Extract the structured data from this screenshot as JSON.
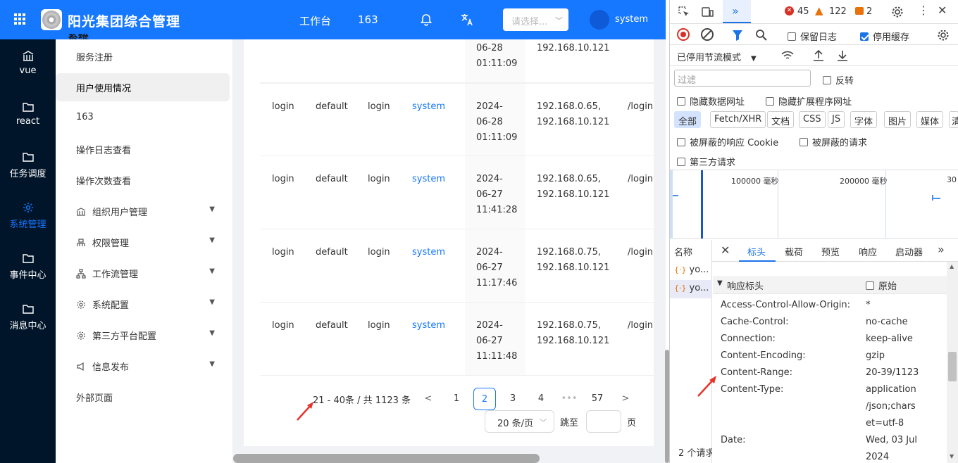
{
  "header": {
    "app_title": "阳光集团综合管理",
    "app_title_overflow": "系统",
    "workbench": "工作台",
    "count": "163",
    "select_placeholder": "请选择...",
    "username": "system"
  },
  "sider": {
    "items": [
      {
        "label": "vue",
        "icon": "bank-icon"
      },
      {
        "label": "react",
        "icon": "folder-icon"
      },
      {
        "label": "任务调度",
        "icon": "folder-icon"
      },
      {
        "label": "系统管理",
        "icon": "gear-icon"
      },
      {
        "label": "事件中心",
        "icon": "folder-icon"
      },
      {
        "label": "消息中心",
        "icon": "folder-icon"
      }
    ]
  },
  "menu": {
    "items": [
      {
        "label": "服务注册"
      },
      {
        "label": "用户使用情况"
      },
      {
        "label": "163"
      },
      {
        "label": "操作日志查看"
      },
      {
        "label": "操作次数查看"
      },
      {
        "label": "组织用户管理",
        "icon": "bank-icon"
      },
      {
        "label": "权限管理",
        "icon": "user-icon"
      },
      {
        "label": "工作流管理",
        "icon": "flow-icon"
      },
      {
        "label": "系统配置",
        "icon": "gear-icon"
      },
      {
        "label": "第三方平台配置",
        "icon": "gear-icon"
      },
      {
        "label": "信息发布",
        "icon": "sound-icon"
      },
      {
        "label": "外部页面"
      }
    ]
  },
  "table": {
    "partial_row": {
      "date1": "06-28",
      "time": "01:11:09",
      "ip": "192.168.10.121"
    },
    "rows": [
      {
        "type": "login",
        "app": "default",
        "op": "login",
        "user": "system",
        "date0": "2024-",
        "date1": "06-28",
        "time": "01:11:09",
        "ip1": "192.168.0.65,",
        "ip2": "192.168.10.121",
        "path": "/login"
      },
      {
        "type": "login",
        "app": "default",
        "op": "login",
        "user": "system",
        "date0": "2024-",
        "date1": "06-27",
        "time": "11:41:28",
        "ip1": "192.168.0.65,",
        "ip2": "192.168.10.121",
        "path": "/login"
      },
      {
        "type": "login",
        "app": "default",
        "op": "login",
        "user": "system",
        "date0": "2024-",
        "date1": "06-27",
        "time": "11:17:46",
        "ip1": "192.168.0.75,",
        "ip2": "192.168.10.121",
        "path": "/login"
      },
      {
        "type": "login",
        "app": "default",
        "op": "login",
        "user": "system",
        "date0": "2024-",
        "date1": "06-27",
        "time": "11:11:48",
        "ip1": "192.168.0.75,",
        "ip2": "192.168.10.121",
        "path": "/login"
      }
    ]
  },
  "pagination": {
    "range": "21 - 40条 / 共 1123 条",
    "pages": [
      "1",
      "2",
      "3",
      "4",
      "•••",
      "57"
    ],
    "current": "2",
    "page_size": "20 条/页",
    "jump_label": "跳至",
    "page_suffix": "页"
  },
  "devtools": {
    "errors": "45",
    "warnings": "122",
    "issues": "2",
    "preserve_log": "保留日志",
    "disable_cache": "停用缓存",
    "throttle": "已停用节流模式",
    "filter_placeholder": "过滤",
    "invert": "反转",
    "hide_data_urls": "隐藏数据网址",
    "hide_ext_urls": "隐藏扩展程序网址",
    "types": [
      "全部",
      "Fetch/XHR",
      "文档",
      "CSS",
      "JS",
      "字体",
      "图片",
      "媒体",
      "清"
    ],
    "blocked_cookies": "被屏蔽的响应 Cookie",
    "blocked_requests": "被屏蔽的请求",
    "third_party": "第三方请求",
    "timeline_labels": [
      "100000 毫秒",
      "200000 毫秒",
      "30"
    ],
    "name_header": "名称",
    "requests": [
      "yo...",
      "yo..."
    ],
    "tabs": [
      "标头",
      "载荷",
      "预览",
      "响应",
      "启动器"
    ],
    "section": "响应标头",
    "raw": "原始",
    "status": "2 个请求",
    "headers": [
      {
        "name": "Access-Control-Allow-Origin:",
        "value": "*"
      },
      {
        "name": "Cache-Control:",
        "value": "no-cache"
      },
      {
        "name": "Connection:",
        "value": "keep-alive"
      },
      {
        "name": "Content-Encoding:",
        "value": "gzip"
      },
      {
        "name": "Content-Range:",
        "value": "20-39/1123"
      },
      {
        "name": "Content-Type:",
        "value": "application"
      },
      {
        "name": "",
        "value": "/json;chars"
      },
      {
        "name": "",
        "value": "et=utf-8"
      },
      {
        "name": "Date:",
        "value": "Wed, 03 Jul"
      },
      {
        "name": "",
        "value": "2024"
      }
    ]
  },
  "colors": {
    "primary": "#1677ff",
    "sider_bg": "#001529",
    "arrow": "#e8332a"
  }
}
